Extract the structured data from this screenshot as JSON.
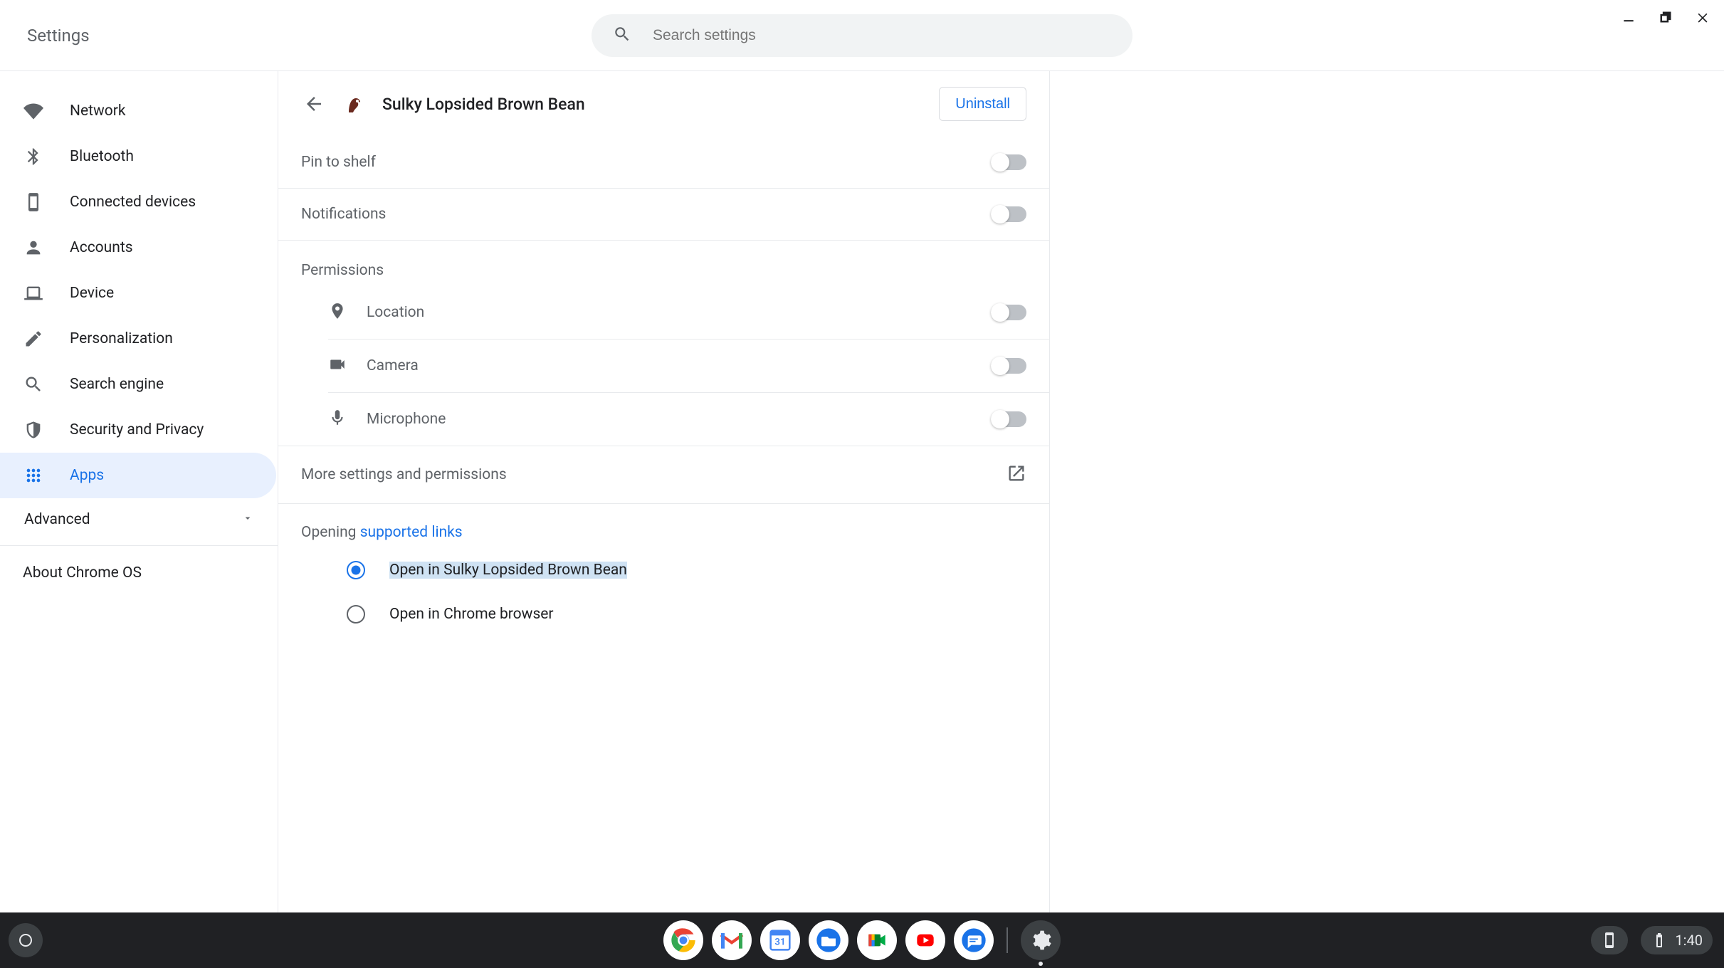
{
  "header": {
    "title": "Settings",
    "search_placeholder": "Search settings"
  },
  "sidebar": {
    "items": [
      {
        "label": "Network"
      },
      {
        "label": "Bluetooth"
      },
      {
        "label": "Connected devices"
      },
      {
        "label": "Accounts"
      },
      {
        "label": "Device"
      },
      {
        "label": "Personalization"
      },
      {
        "label": "Search engine"
      },
      {
        "label": "Security and Privacy"
      },
      {
        "label": "Apps"
      }
    ],
    "advanced": "Advanced",
    "about": "About Chrome OS"
  },
  "main": {
    "app_name": "Sulky Lopsided Brown Bean",
    "uninstall": "Uninstall",
    "pin_to_shelf": "Pin to shelf",
    "notifications": "Notifications",
    "permissions": "Permissions",
    "perm": {
      "location": "Location",
      "camera": "Camera",
      "microphone": "Microphone"
    },
    "more": "More settings and permissions",
    "opening_prefix": "Opening ",
    "opening_link": "supported links",
    "radio_app": "Open in Sulky Lopsided Brown Bean",
    "radio_chrome": "Open in Chrome browser"
  },
  "shelf": {
    "clock": "1:40"
  }
}
